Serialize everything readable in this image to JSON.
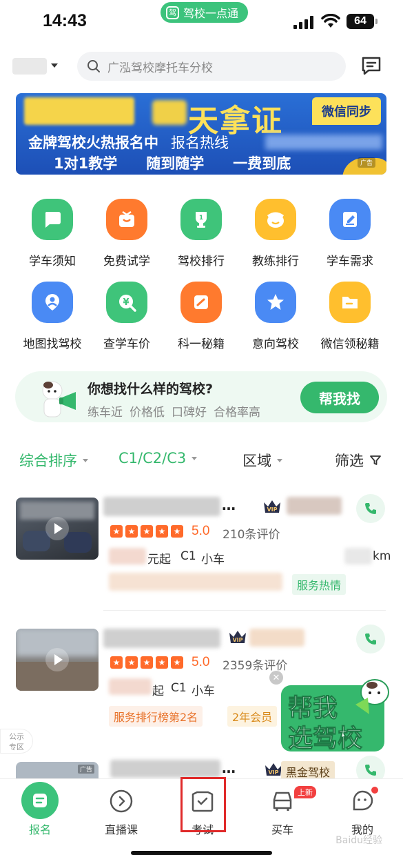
{
  "status_bar": {
    "time": "14:43",
    "app_pill": "驾校一点通",
    "battery": "64"
  },
  "header": {
    "search_placeholder": "广泓驾校摩托车分校"
  },
  "banner": {
    "slogan": "天拿证",
    "wechat_sync": "微信同步",
    "line1_a": "金牌驾校火热报名中",
    "line1_b": "报名热线",
    "line2": [
      "1对1教学",
      "随到随学",
      "一费到底"
    ],
    "ad_label": "广告"
  },
  "quick_grid": [
    {
      "label": "学车须知",
      "icon": "chat-bubble-icon",
      "color": "#3fc47a"
    },
    {
      "label": "免费试学",
      "icon": "gift-icon",
      "color": "#ff7a2e"
    },
    {
      "label": "驾校排行",
      "icon": "trophy-icon",
      "color": "#3fc47a"
    },
    {
      "label": "教练排行",
      "icon": "coach-face-icon",
      "color": "#ffbf2e"
    },
    {
      "label": "学车需求",
      "icon": "edit-note-icon",
      "color": "#4a8af4"
    },
    {
      "label": "地图找驾校",
      "icon": "map-person-icon",
      "color": "#4a8af4"
    },
    {
      "label": "查学车价",
      "icon": "price-search-icon",
      "color": "#3fc47a"
    },
    {
      "label": "科一秘籍",
      "icon": "book-icon",
      "color": "#ff7a2e"
    },
    {
      "label": "意向驾校",
      "icon": "star-badge-icon",
      "color": "#4a8af4"
    },
    {
      "label": "微信领秘籍",
      "icon": "folder-icon",
      "color": "#ffbf2e"
    }
  ],
  "help_strip": {
    "question": "你想找什么样的驾校?",
    "tags": [
      "练车近",
      "价格低",
      "口碑好",
      "合格率高"
    ],
    "button": "帮我找"
  },
  "filters": {
    "sort": "综合排序",
    "license": "C1/C2/C3",
    "area": "区域",
    "filter": "筛选"
  },
  "schools": [
    {
      "name_tail": "…",
      "score": "5.0",
      "reviews": "210条评价",
      "price_text": "元起",
      "license": "C1",
      "vehicle": "小车",
      "distance_tail": "km",
      "tags": [
        "服务热情"
      ]
    },
    {
      "name_tail": "…",
      "score": "5.0",
      "reviews": "2359条评价",
      "price_text": "起",
      "license": "C1",
      "vehicle": "小车",
      "tags": [
        "服务排行榜第2名",
        "2年会员"
      ]
    },
    {
      "name_tail": "…",
      "badge": "黑金驾校",
      "ad_label": "广告"
    }
  ],
  "float_ad": {
    "text_line1": "帮我",
    "text_line2": "选驾校"
  },
  "side_tag": {
    "line1": "公示",
    "line2": "专区"
  },
  "tabbar": [
    {
      "label": "报名",
      "icon": "signup-icon"
    },
    {
      "label": "直播课",
      "icon": "play-circle-icon"
    },
    {
      "label": "考试",
      "icon": "exam-check-icon"
    },
    {
      "label": "买车",
      "icon": "car-icon",
      "badge": "上新"
    },
    {
      "label": "我的",
      "icon": "profile-icon"
    }
  ],
  "watermark": "Baidu经验",
  "colors": {
    "brand_green": "#3cc37c",
    "orange": "#ff6a2a",
    "highlight_red": "#e02a2a"
  }
}
